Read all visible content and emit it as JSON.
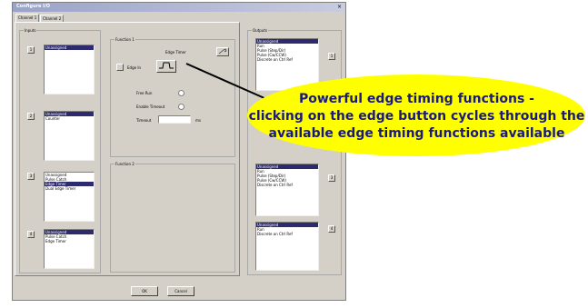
{
  "window": {
    "title": "Configure I/O",
    "close_icon": "close-icon"
  },
  "tabs": [
    {
      "label": "Channel 1"
    },
    {
      "label": "Channel 2"
    }
  ],
  "inputs": {
    "title": "Inputs",
    "lists": [
      {
        "button": "1",
        "items": [
          "Unassigned"
        ],
        "selected": 0
      },
      {
        "button": "2",
        "items": [
          "Unassigned",
          "Counter"
        ],
        "selected": 0
      },
      {
        "button": "3",
        "items": [
          "Unassigned",
          "Pulse Catch",
          "Edge Timer",
          "Dual Edge Timer"
        ],
        "selected": 2
      },
      {
        "button": "4",
        "items": [
          "Unassigned",
          "Pulse Catch",
          "Edge Timer"
        ],
        "selected": 0
      }
    ]
  },
  "function1": {
    "title": "Function 1",
    "header": "Edge Timer",
    "edge_label": "Edge In",
    "edge_button": "edge-waveform-icon",
    "free_run_label": "Free Run",
    "enable_timeout_label": "Enable Timeout",
    "timeout_label": "Timeout",
    "timeout_unit": "ms"
  },
  "function2": {
    "title": "Function 2"
  },
  "outputs": {
    "title": "Outputs",
    "lists": [
      {
        "button": "1",
        "items": [
          "Unassigned",
          "Run",
          "Pulse (Step/Dir)",
          "Pulse (Cw/CCW)",
          "Discrete on Ctrl Ref"
        ],
        "selected": 0
      },
      {
        "button": "3",
        "items": [
          "Unassigned",
          "Run",
          "Pulse (Step/Dir)",
          "Pulse (Cw/CCW)",
          "Discrete on Ctrl Ref"
        ],
        "selected": 0
      },
      {
        "button": "4",
        "items": [
          "Unassigned",
          "Run",
          "Discrete on Ctrl Ref"
        ],
        "selected": 0
      }
    ]
  },
  "buttons": {
    "ok": "OK",
    "cancel": "Cancel"
  },
  "callout": {
    "lines": [
      "Powerful edge timing functions -",
      "clicking on the edge button cycles through the",
      "available edge timing functions available"
    ],
    "color": "#ffff00",
    "text_color": "#1a1a7a"
  }
}
